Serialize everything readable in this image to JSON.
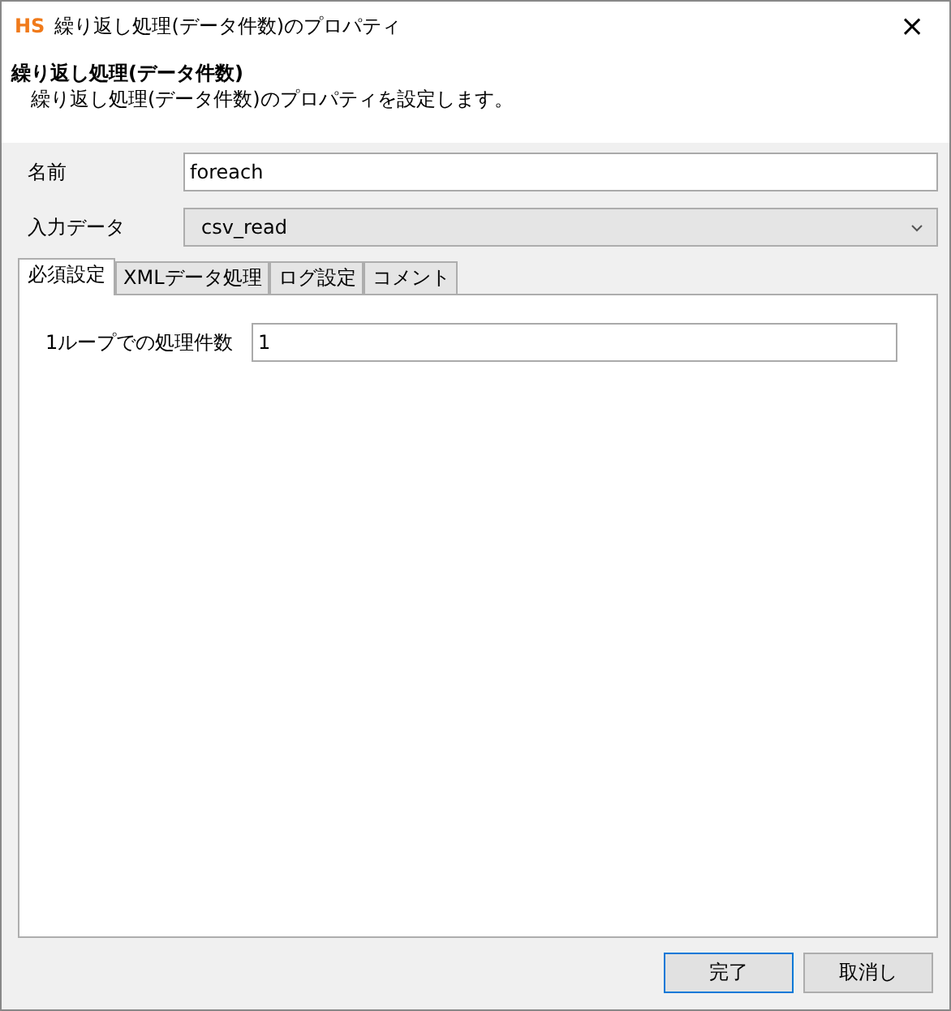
{
  "window": {
    "logo": "HS",
    "title": "繰り返し処理(データ件数)のプロパティ",
    "close": "×"
  },
  "header": {
    "title": "繰り返し処理(データ件数)",
    "description": "繰り返し処理(データ件数)のプロパティを設定します。"
  },
  "name_field": {
    "label": "名前",
    "value": "foreach"
  },
  "input_data": {
    "label": "入力データ",
    "value": "csv_read"
  },
  "tabs": [
    {
      "label": "必須設定",
      "selected": true
    },
    {
      "label": "XMLデータ処理",
      "selected": false
    },
    {
      "label": "ログ設定",
      "selected": false
    },
    {
      "label": "コメント",
      "selected": false
    }
  ],
  "panel": {
    "label": "1ループでの処理件数",
    "value": "1"
  },
  "buttons": [
    {
      "label": "完了",
      "default": true
    },
    {
      "label": "取消し",
      "default": false
    }
  ]
}
